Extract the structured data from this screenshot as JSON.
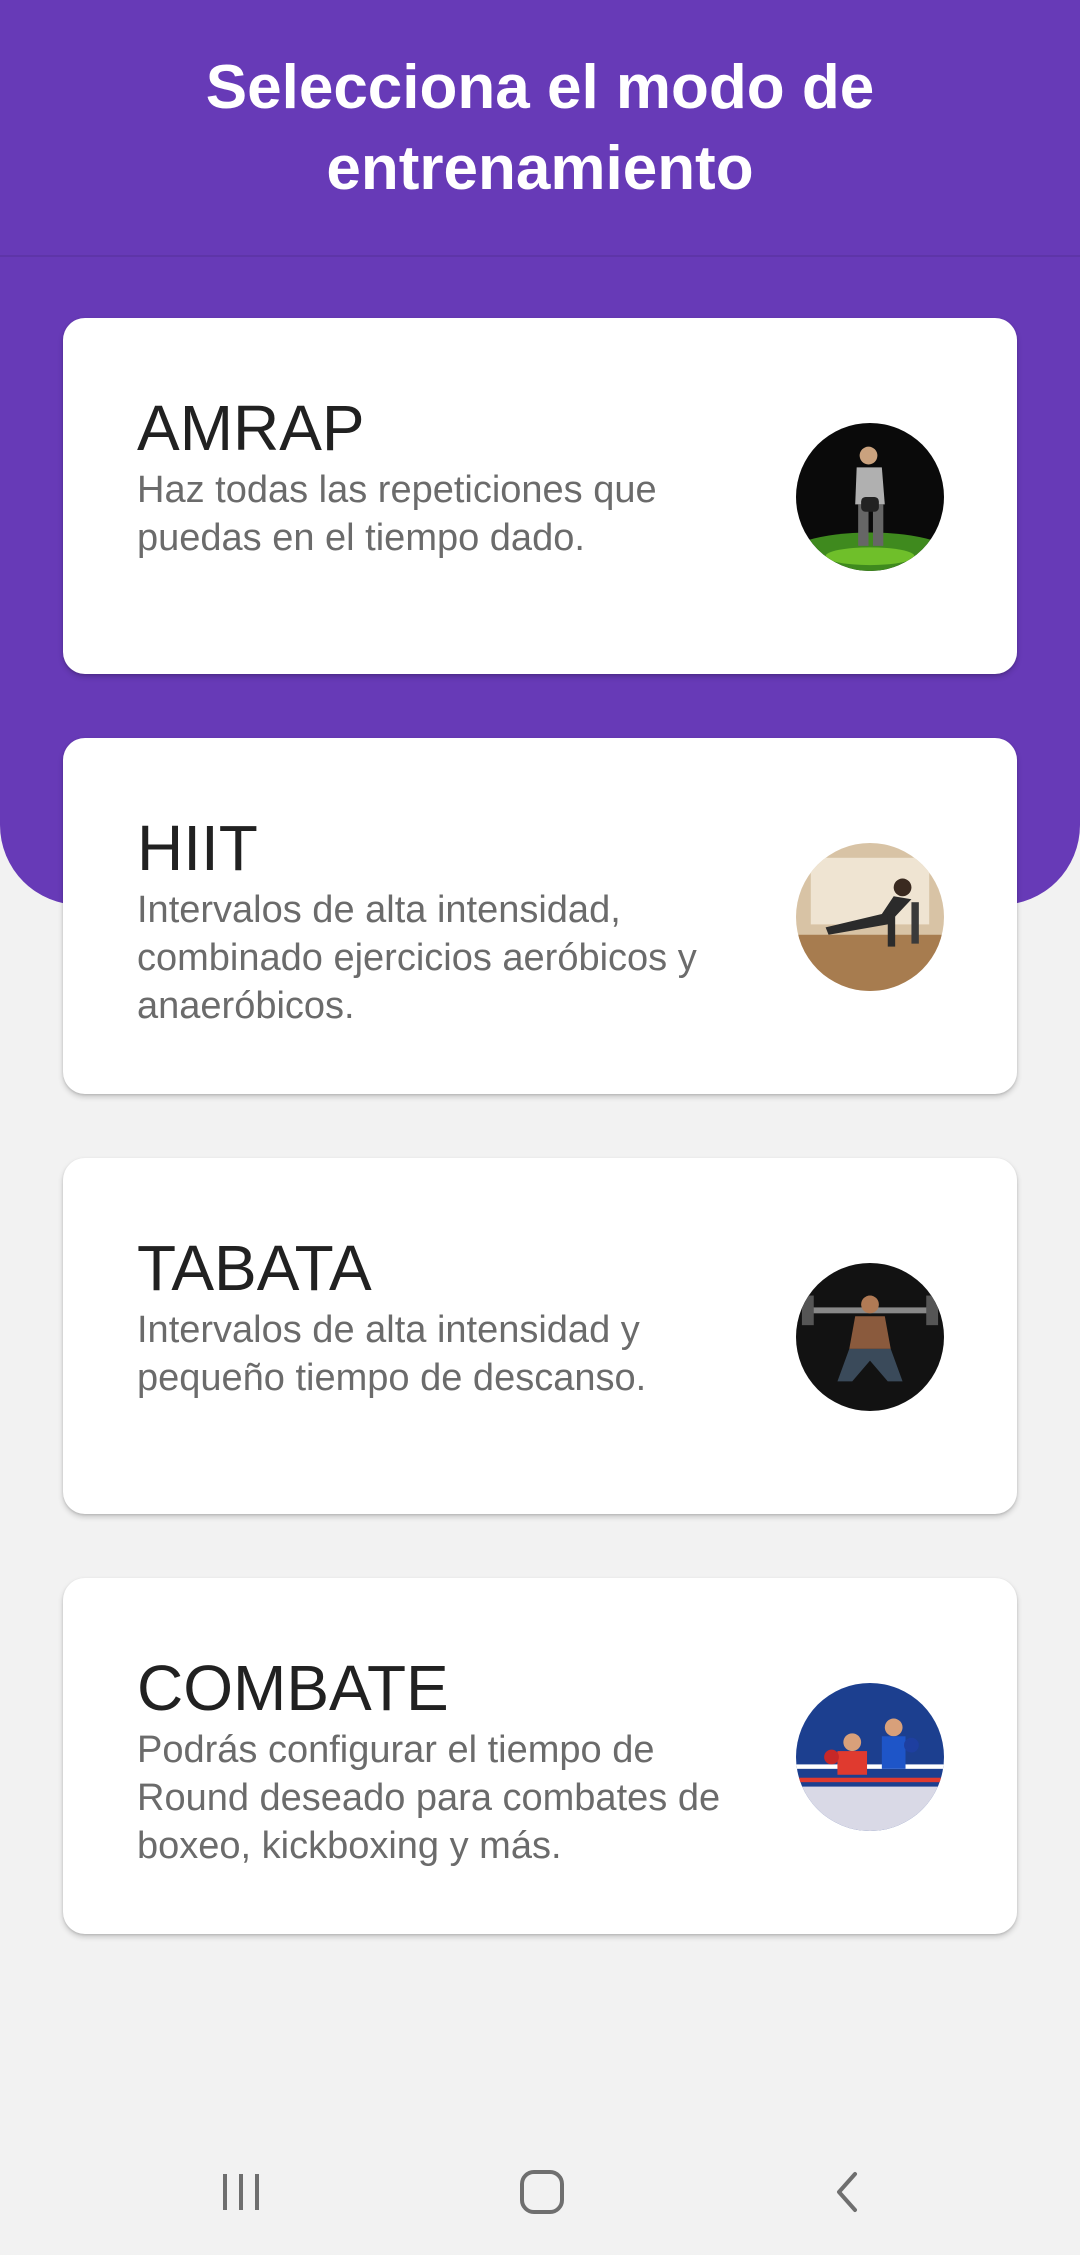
{
  "header": {
    "title": "Selecciona el modo de entrenamiento"
  },
  "modes": [
    {
      "title": "AMRAP",
      "description": "Haz todas las repeticiones que puedas en el tiempo dado.",
      "image": "athlete-kettlebell-photo"
    },
    {
      "title": "HIIT",
      "description": "Intervalos de alta intensidad, combinado ejercicios aeróbicos y anaeróbicos.",
      "image": "athlete-plank-photo"
    },
    {
      "title": "TABATA",
      "description": "Intervalos de alta intensidad y pequeño tiempo de descanso.",
      "image": "athlete-squat-barbell-photo"
    },
    {
      "title": "COMBATE",
      "description": "Podrás configurar el tiempo de Round deseado para combates de boxeo, kickboxing y más.",
      "image": "boxing-ring-photo"
    }
  ],
  "navigation": {
    "recents": "recents-icon",
    "home": "home-icon",
    "back": "back-icon"
  },
  "colors": {
    "primary": "#673ab7",
    "background": "#f2f2f2",
    "card": "#ffffff"
  }
}
